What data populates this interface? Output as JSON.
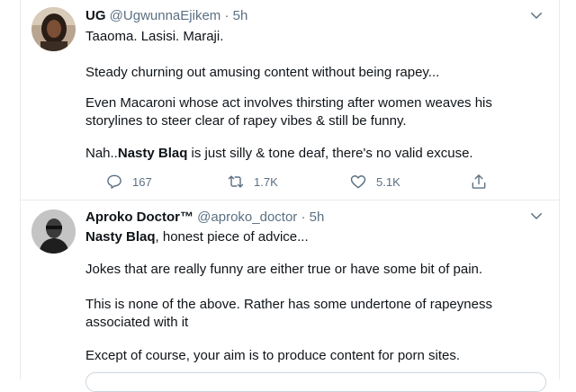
{
  "tweets": [
    {
      "name": "UG",
      "handle": "@UgwunnaEjikem",
      "dot": "·",
      "time": "5h",
      "paragraphs": [
        "Taaoma. Lasisi. Maraji.",
        "Steady churning out amusing content without being rapey...",
        "Even Macaroni whose act involves thirsting after women weaves his storylines to steer clear of rapey vibes & still be funny."
      ],
      "last_prefix": "Nah..",
      "last_bold": "Nasty Blaq",
      "last_rest": " is just silly & tone deaf, there's no valid excuse.",
      "replies": "167",
      "retweets": "1.7K",
      "likes": "5.1K"
    },
    {
      "name": "Aproko Doctor™",
      "handle": "@aproko_doctor",
      "dot": "·",
      "time": "5h",
      "first_bold": "Nasty Blaq",
      "first_rest": ", honest piece of advice...",
      "paragraphs": [
        "Jokes that are really funny are either true or have some bit of pain.",
        "This is none of the above. Rather has some undertone of rapeyness associated with it",
        "Except of course, your aim is to produce content for porn sites."
      ]
    }
  ],
  "icons": {
    "reply": "reply-icon",
    "retweet": "retweet-icon",
    "like": "heart-icon",
    "share": "share-icon",
    "caret": "chevron-down-icon"
  },
  "colors": {
    "text": "#0f1419",
    "secondary": "#5b7083",
    "border": "#e6ecf0"
  }
}
